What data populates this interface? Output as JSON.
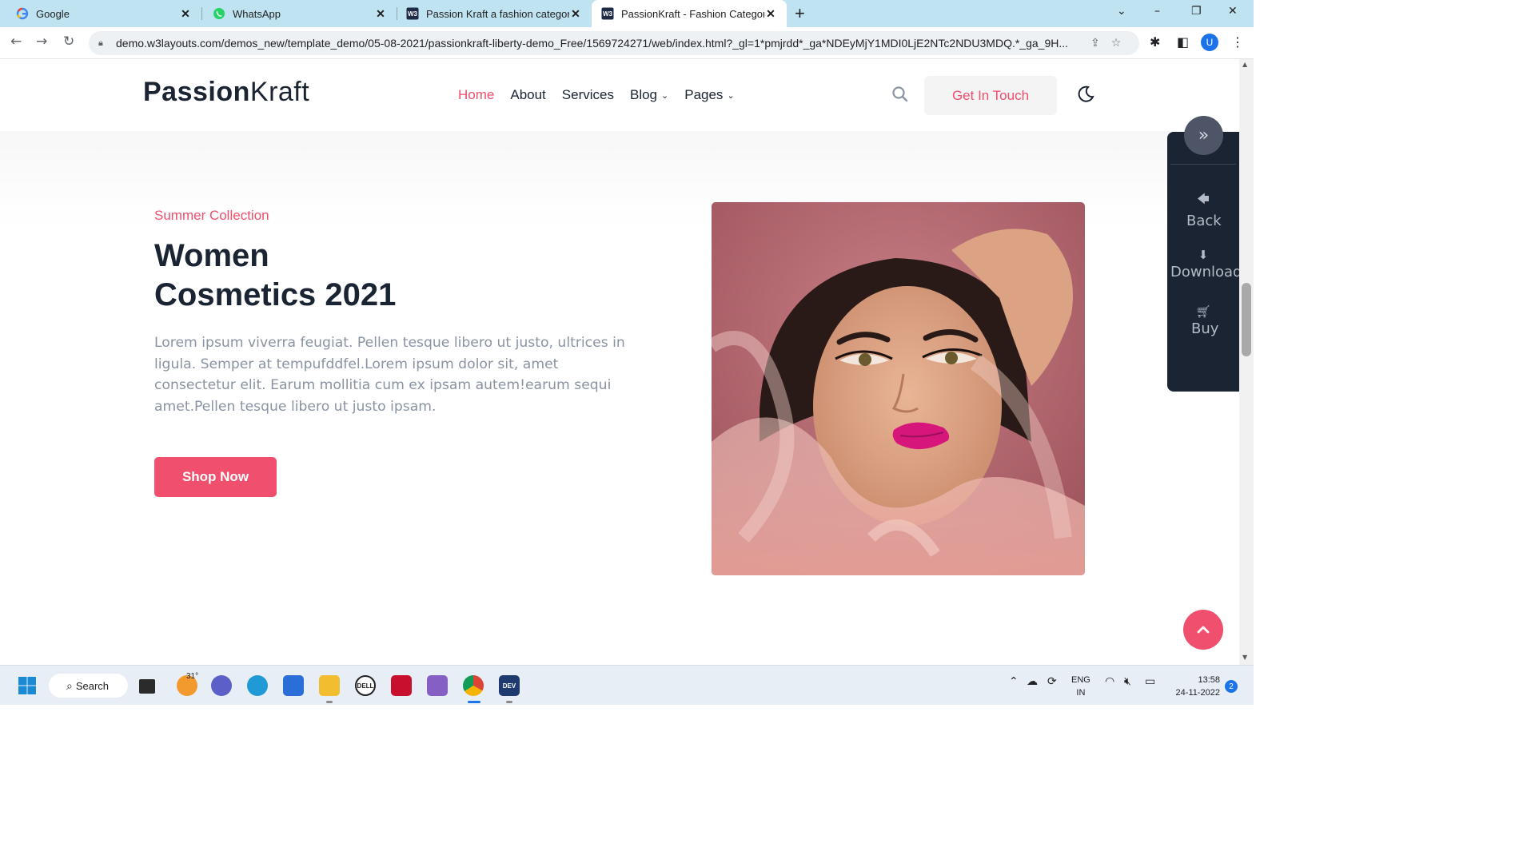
{
  "browser": {
    "tabs": [
      {
        "title": "Google",
        "icon": "google-icon"
      },
      {
        "title": "WhatsApp",
        "icon": "whatsapp-icon"
      },
      {
        "title": "Passion Kraft a fashion category w",
        "icon": "w3layouts-icon"
      },
      {
        "title": "PassionKraft - Fashion Category B",
        "icon": "w3layouts-icon",
        "active": true
      }
    ],
    "new_tab": "+",
    "url_host": "demo.w3layouts.com",
    "url_path": "/demos_new/template_demo/05-08-2021/passionkraft-liberty-demo_Free/1569724271/web/index.html?_gl=1*pmjrdd*_ga*NDEyMjY1MDI0LjE2NTc2NDU3MDQ.*_ga_9H...",
    "profile_initial": "U"
  },
  "site": {
    "logo_bold": "Passion",
    "logo_light": "Kraft",
    "nav": [
      {
        "label": "Home",
        "active": true
      },
      {
        "label": "About"
      },
      {
        "label": "Services"
      },
      {
        "label": "Blog",
        "dropdown": true
      },
      {
        "label": "Pages",
        "dropdown": true
      }
    ],
    "cta": "Get In Touch",
    "accent": "#f04f6d",
    "dark": "#1b2433"
  },
  "hero": {
    "eyebrow": "Summer Collection",
    "title_line1": "Women",
    "title_line2": "Cosmetics 2021",
    "description": "Lorem ipsum viverra feugiat. Pellen tesque libero ut justo, ultrices in ligula. Semper at tempufddfel.Lorem ipsum dolor sit, amet consectetur elit. Earum mollitia cum ex ipsam autem!earum sequi amet.Pellen tesque libero ut justo ipsam.",
    "button": "Shop Now"
  },
  "side_panel": {
    "toggle": "»",
    "items": [
      {
        "label": "Back",
        "icon": "arrow-left-icon"
      },
      {
        "label": "Download",
        "icon": "download-icon"
      },
      {
        "label": "Buy",
        "icon": "cart-icon"
      }
    ]
  },
  "taskbar": {
    "search_label": "Search",
    "weather_temp": "31°",
    "lang_line1": "ENG",
    "lang_line2": "IN",
    "time": "13:58",
    "date": "24-11-2022",
    "notifications": "2"
  }
}
